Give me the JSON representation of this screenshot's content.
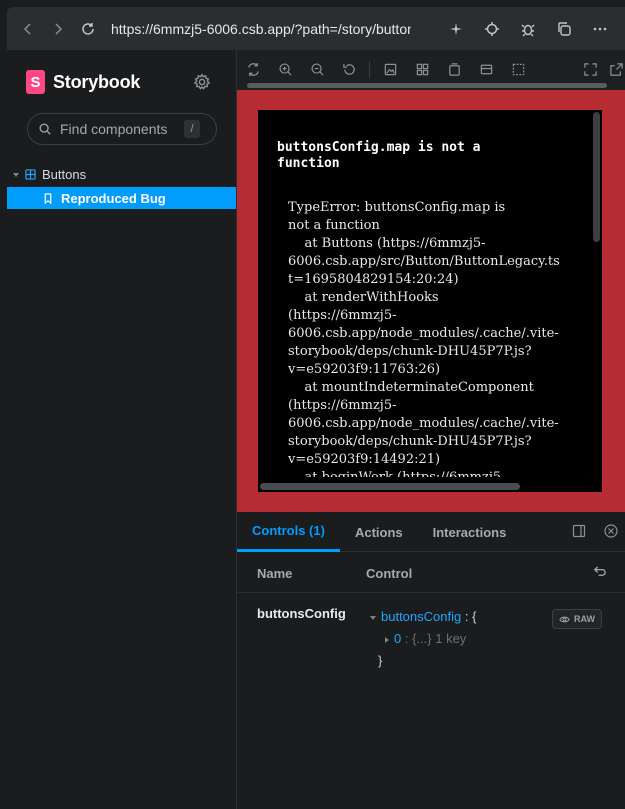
{
  "browser": {
    "url": "https://6mmzj5-6006.csb.app/?path=/story/buttons"
  },
  "sidebar": {
    "brand": "Storybook",
    "search_placeholder": "Find components",
    "search_shortcut": "/",
    "tree": {
      "group": "Buttons",
      "items": [
        {
          "label": "Reproduced Bug",
          "selected": true
        }
      ]
    }
  },
  "preview": {
    "error_title": "buttonsConfig.map is not a function",
    "error_stack": "TypeError: buttonsConfig.map is\nnot a function\n    at Buttons (https://6mmzj5-\n6006.csb.app/src/Button/ButtonLegacy.ts\nt=1695804829154:20:24)\n    at renderWithHooks\n(https://6mmzj5-\n6006.csb.app/node_modules/.cache/.vite-\nstorybook/deps/chunk-DHU45P7P.js?\nv=e59203f9:11763:26)\n    at mountIndeterminateComponent\n(https://6mmzj5-\n6006.csb.app/node_modules/.cache/.vite-\nstorybook/deps/chunk-DHU45P7P.js?\nv=e59203f9:14492:21)\n    at beginWork (https://6mmzj5-"
  },
  "panel": {
    "tabs": [
      {
        "label": "Controls (1)",
        "active": true
      },
      {
        "label": "Actions",
        "active": false
      },
      {
        "label": "Interactions",
        "active": false
      }
    ],
    "header": {
      "name": "Name",
      "control": "Control"
    },
    "rows": [
      {
        "name": "buttonsConfig",
        "json_key": "buttonsConfig",
        "json_sep": " : ",
        "json_open": "{",
        "child_key": "0",
        "child_sep": " : ",
        "child_summary": "{...}",
        "child_count": "1 key",
        "json_close": "}",
        "raw_label": "RAW"
      }
    ]
  },
  "colors": {
    "accent": "#029cfd",
    "brand": "#ff4785",
    "error_frame": "#b72c33"
  }
}
